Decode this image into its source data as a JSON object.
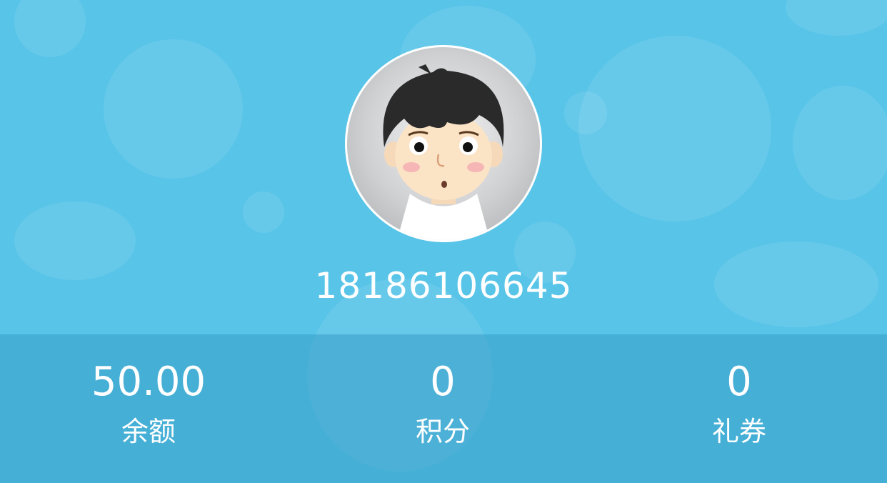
{
  "colors": {
    "background": "#58c4e8",
    "stats_bar": "#4aa7cf",
    "text": "#ffffff"
  },
  "profile": {
    "avatar_icon": "cartoon-boy-avatar",
    "username": "18186106645"
  },
  "stats": [
    {
      "value": "50.00",
      "label": "余额"
    },
    {
      "value": "0",
      "label": "积分"
    },
    {
      "value": "0",
      "label": "礼券"
    }
  ]
}
